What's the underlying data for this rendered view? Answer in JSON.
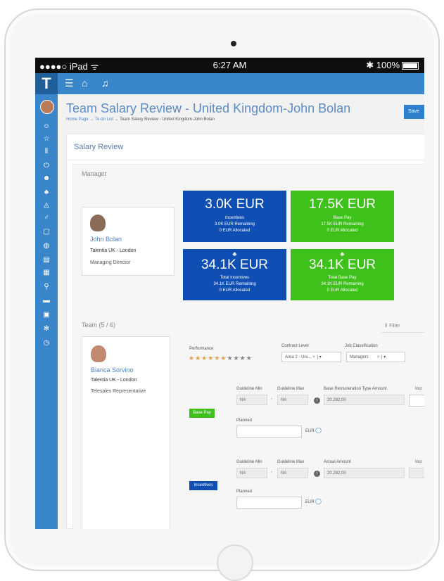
{
  "status": {
    "carrier": "●●●●○ iPad",
    "wifi": "ᯤ",
    "time": "6:27 AM",
    "bluetooth": "✱",
    "battery": "100%"
  },
  "nav": {
    "logo": "T",
    "menu_icon": "menu-icon",
    "home_icon": "home-icon",
    "bell_icon": "bell-icon"
  },
  "header": {
    "title": "Team Salary Review - United Kingdom-John Bolan",
    "breadcrumb": [
      "Home Page",
      "To-do List",
      "Team Salary Review - United Kingdom-John Bolan"
    ],
    "save_label": "Save"
  },
  "panel": {
    "title": "Salary Review",
    "manager_label": "Manager",
    "team_label": "Team (5 / 6)",
    "filter_label": "Filter"
  },
  "manager": {
    "name": "John Bolan",
    "org": "Talentia UK - London",
    "role": "Managing Director"
  },
  "tiles": [
    {
      "amount": "3.0K EUR",
      "label": "Incentives",
      "remaining": "3.0K EUR Remaining",
      "allocated": "0 EUR Allocated",
      "color": "#0f4fb3"
    },
    {
      "amount": "17.5K EUR",
      "label": "Base Pay",
      "remaining": "17.5K EUR Remaining",
      "allocated": "0 EUR Allocated",
      "color": "#3ec11a"
    },
    {
      "amount": "34.1K EUR",
      "label": "Total Incentives",
      "remaining": "34.1K EUR Remaining",
      "allocated": "0 EUR Allocated",
      "color": "#0f4fb3"
    },
    {
      "amount": "34.1K EUR",
      "label": "Total Base Pay",
      "remaining": "34.1K EUR Remaining",
      "allocated": "0 EUR Allocated",
      "color": "#3ec11a"
    }
  ],
  "employee": {
    "name": "Bianca Sorvino",
    "org": "Talentia UK - London",
    "role": "Telesales Representative",
    "performance_label": "Performance",
    "performance_stars": 6,
    "performance_max": 10,
    "contract_label": "Contract Level",
    "contract_value": "Area 2 - Uni...",
    "job_label": "Job Classification",
    "job_value": "Managers"
  },
  "base_pay": {
    "badge": "Base Pay",
    "gmin_label": "Guideline Min",
    "gmax_label": "Guideline Max",
    "amount_label": "Base Remuneration Type Amount",
    "extra_label": "Incr",
    "gmin": "NA",
    "gmax": "NA",
    "amount": "20.292,00",
    "planned_label": "Planned",
    "currency": "EUR"
  },
  "incentives": {
    "badge": "Incentives",
    "gmin_label": "Guideline Min",
    "gmax_label": "Guideline Max",
    "amount_label": "Actual Amount",
    "extra_label": "Incr",
    "gmin": "NA",
    "gmax": "NA",
    "amount": "20.292,00",
    "planned_label": "Planned",
    "currency": "EUR"
  }
}
